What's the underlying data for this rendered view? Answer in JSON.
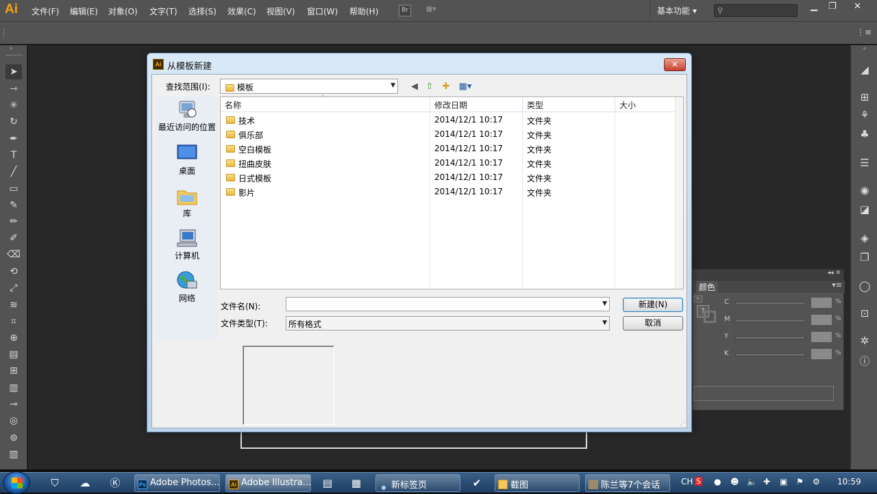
{
  "app": {
    "logo": "Ai"
  },
  "menubar": {
    "items": [
      "文件(F)",
      "编辑(E)",
      "对象(O)",
      "文字(T)",
      "选择(S)",
      "效果(C)",
      "视图(V)",
      "窗口(W)",
      "帮助(H)"
    ],
    "bridge": "Br",
    "workspace": "基本功能",
    "search_placeholder": ""
  },
  "color_panel": {
    "title": "颜色",
    "channels": [
      {
        "label": "C",
        "unit": "%"
      },
      {
        "label": "M",
        "unit": "%"
      },
      {
        "label": "Y",
        "unit": "%"
      },
      {
        "label": "K",
        "unit": "%"
      }
    ]
  },
  "dialog": {
    "title": "从模板新建",
    "close": "✕",
    "look_in_label": "查找范围(I):",
    "look_in_value": "模板",
    "places": [
      {
        "label": "最近访问的位置",
        "icon": "recent-places-icon"
      },
      {
        "label": "桌面",
        "icon": "desktop-icon"
      },
      {
        "label": "库",
        "icon": "libraries-icon"
      },
      {
        "label": "计算机",
        "icon": "computer-icon"
      },
      {
        "label": "网络",
        "icon": "network-icon"
      }
    ],
    "columns": [
      "名称",
      "修改日期",
      "类型",
      "大小"
    ],
    "files": [
      {
        "name": "技术",
        "date": "2014/12/1 10:17",
        "type": "文件夹",
        "size": ""
      },
      {
        "name": "俱乐部",
        "date": "2014/12/1 10:17",
        "type": "文件夹",
        "size": ""
      },
      {
        "name": "空白模板",
        "date": "2014/12/1 10:17",
        "type": "文件夹",
        "size": ""
      },
      {
        "name": "扭曲皮肤",
        "date": "2014/12/1 10:17",
        "type": "文件夹",
        "size": ""
      },
      {
        "name": "日式模板",
        "date": "2014/12/1 10:17",
        "type": "文件夹",
        "size": ""
      },
      {
        "name": "影片",
        "date": "2014/12/1 10:17",
        "type": "文件夹",
        "size": ""
      }
    ],
    "filename_label": "文件名(N):",
    "filename_value": "",
    "filetype_label": "文件类型(T):",
    "filetype_value": "所有格式",
    "new_button": "新建(N)",
    "cancel_button": "取消"
  },
  "taskbar": {
    "tasks": [
      {
        "label": "Adobe Photos...",
        "icon": "Ps"
      },
      {
        "label": "Adobe Illustra...",
        "icon": "Ai"
      },
      {
        "label": "新标签页",
        "icon": "browser"
      },
      {
        "label": "截图",
        "icon": "folder"
      },
      {
        "label": "陈兰等7个会话",
        "icon": "chat"
      }
    ],
    "ime": "CH",
    "clock": "10:59"
  }
}
